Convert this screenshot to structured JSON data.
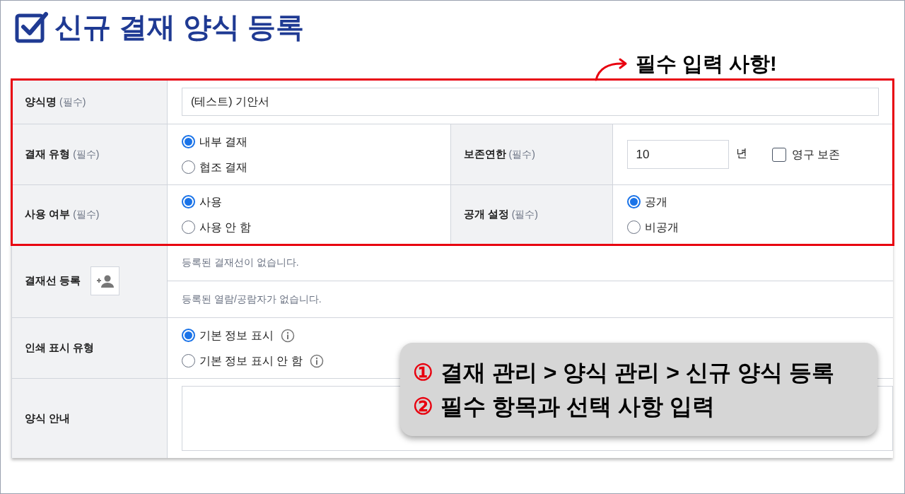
{
  "title": "신규 결재 양식 등록",
  "callout": "필수 입력 사항!",
  "required_rows": [
    {
      "kind": "text",
      "label": "양식명",
      "note": "(필수)",
      "value": "(테스트) 기안서"
    },
    {
      "kind": "split",
      "cells": [
        {
          "label": "결재 유형",
          "note": "(필수)",
          "control": {
            "kind": "radio",
            "options": [
              {
                "label": "내부 결재",
                "selected": true
              },
              {
                "label": "협조 결재",
                "selected": false
              }
            ]
          }
        },
        {
          "label": "보존연한",
          "note": "(필수)",
          "control": {
            "kind": "years",
            "value": "10",
            "unit": "년",
            "checkbox": {
              "label": "영구 보존",
              "checked": false
            }
          }
        }
      ]
    },
    {
      "kind": "split",
      "cells": [
        {
          "label": "사용 여부",
          "note": "(필수)",
          "control": {
            "kind": "radio",
            "options": [
              {
                "label": "사용",
                "selected": true
              },
              {
                "label": "사용 안 함",
                "selected": false
              }
            ]
          }
        },
        {
          "label": "공개 설정",
          "note": "(필수)",
          "control": {
            "kind": "radio",
            "options": [
              {
                "label": "공개",
                "selected": true
              },
              {
                "label": "비공개",
                "selected": false
              }
            ]
          }
        }
      ]
    }
  ],
  "optional_rows": [
    {
      "kind": "approval",
      "label": "결재선 등록",
      "lines": [
        "등록된 결재선이 없습니다.",
        "등록된 열람/공람자가 없습니다."
      ]
    },
    {
      "kind": "radio",
      "label": "인쇄 표시 유형",
      "options": [
        {
          "label": "기본 정보 표시",
          "selected": true,
          "info": true
        },
        {
          "label": "기본 정보 표시 안 함",
          "selected": false,
          "info": true
        }
      ]
    },
    {
      "kind": "textarea",
      "label": "양식 안내"
    }
  ],
  "steps": [
    {
      "number": "①",
      "text": "결재 관리 > 양식 관리 > 신규 양식 등록"
    },
    {
      "number": "②",
      "text": "필수 항목과 선택 사항 입력"
    }
  ]
}
